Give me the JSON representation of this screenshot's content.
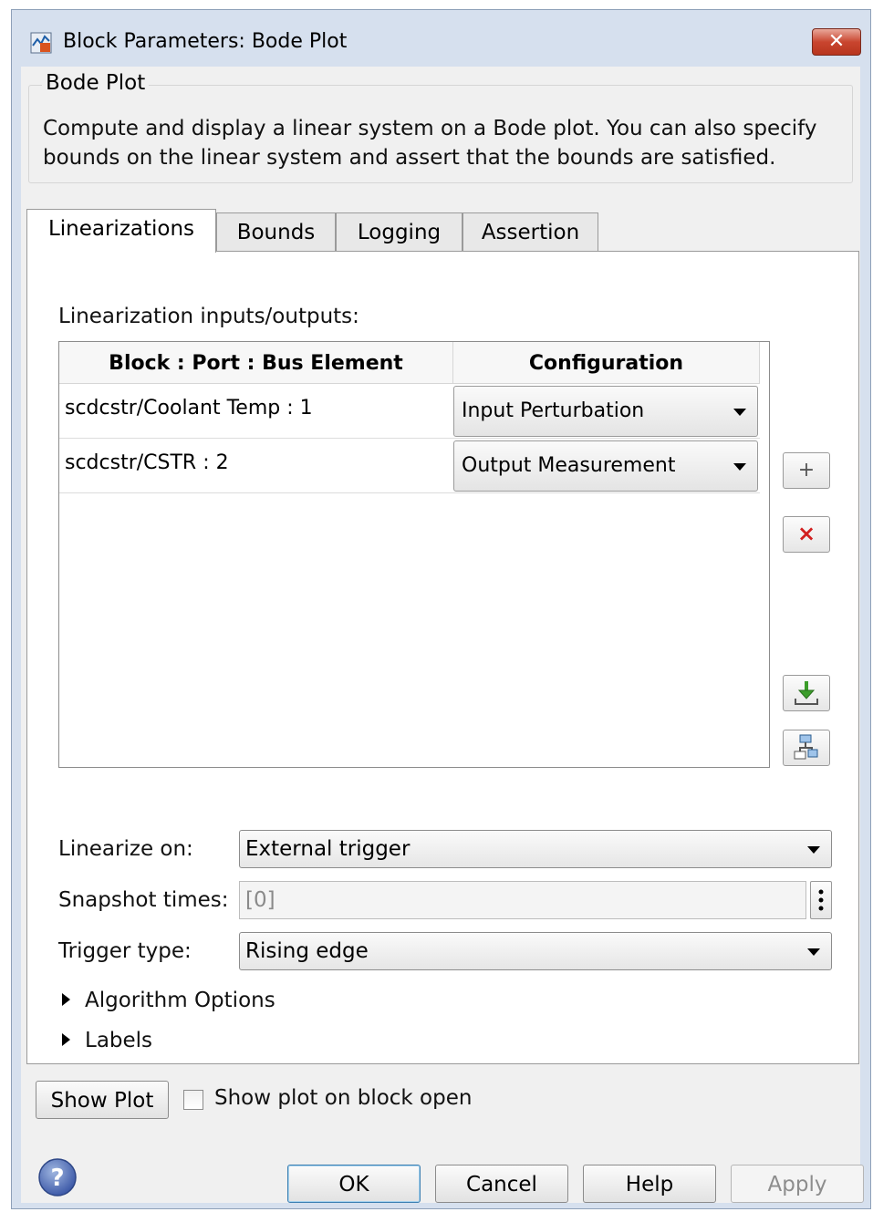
{
  "window": {
    "title": "Block Parameters: Bode Plot",
    "title_icon": "simulink-block-icon",
    "close_icon": "close-icon"
  },
  "group": {
    "label": "Bode Plot",
    "description": "Compute and display a linear system on a Bode plot. You can also specify bounds on the linear system and assert that the bounds are satisfied."
  },
  "tabs": [
    {
      "label": "Linearizations",
      "active": true
    },
    {
      "label": "Bounds",
      "active": false
    },
    {
      "label": "Logging",
      "active": false
    },
    {
      "label": "Assertion",
      "active": false
    }
  ],
  "linearization": {
    "section_label": "Linearization inputs/outputs:",
    "columns": [
      "Block : Port : Bus Element",
      "Configuration"
    ],
    "rows": [
      {
        "block": "scdcstr/Coolant Temp : 1",
        "config": "Input Perturbation"
      },
      {
        "block": "scdcstr/CSTR : 2",
        "config": "Output Measurement"
      }
    ],
    "side_buttons": {
      "add": "+",
      "delete": "×"
    }
  },
  "linearize_on": {
    "label": "Linearize on:",
    "value": "External trigger"
  },
  "snapshot_times": {
    "label": "Snapshot times:",
    "value": "[0]"
  },
  "trigger_type": {
    "label": "Trigger type:",
    "value": "Rising edge"
  },
  "expanders": {
    "algorithm": "Algorithm Options",
    "labels": "Labels"
  },
  "show_plot": {
    "button": "Show Plot",
    "checkbox_label": "Show plot on block open",
    "checked": false
  },
  "footer": {
    "ok": "OK",
    "cancel": "Cancel",
    "help": "Help",
    "apply": "Apply"
  },
  "colors": {
    "frame": "#d6e0ee",
    "client": "#f0f0f0",
    "close_red": "#c9452f",
    "default_button_border": "#3c7fb1",
    "delete_x": "#d21f1f",
    "import_green": "#3b9d2a"
  }
}
